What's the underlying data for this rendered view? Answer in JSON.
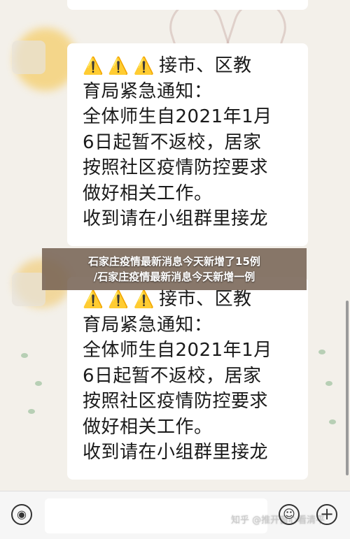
{
  "messages": [
    {
      "warnings": [
        "⚠️",
        "⚠️",
        "⚠️"
      ],
      "lines": [
        "接市、区教",
        "育局紧急通知：",
        "全体师生自2021年1月",
        "6日起暂不返校，居家",
        "按照社区疫情防控要求",
        "做好相关工作。",
        "收到请在小组群里接龙"
      ]
    },
    {
      "warnings": [
        "⚠️",
        "⚠️",
        "⚠️"
      ],
      "lines": [
        "接市、区教",
        "育局紧急通知：",
        "全体师生自2021年1月",
        "6日起暂不返校，居家",
        "按照社区疫情防控要求",
        "做好相关工作。",
        "收到请在小组群里接龙"
      ]
    }
  ],
  "caption": {
    "line1": "石家庄疫情最新消息今天新增了15例",
    "line2": "/石家庄疫情最新消息今天新增一例"
  },
  "input_bar": {
    "voice_icon": "voice-icon",
    "emoji_icon": "emoji-icon",
    "plus_icon": "plus-icon"
  },
  "watermark": "知乎 @推开窗心看清平"
}
